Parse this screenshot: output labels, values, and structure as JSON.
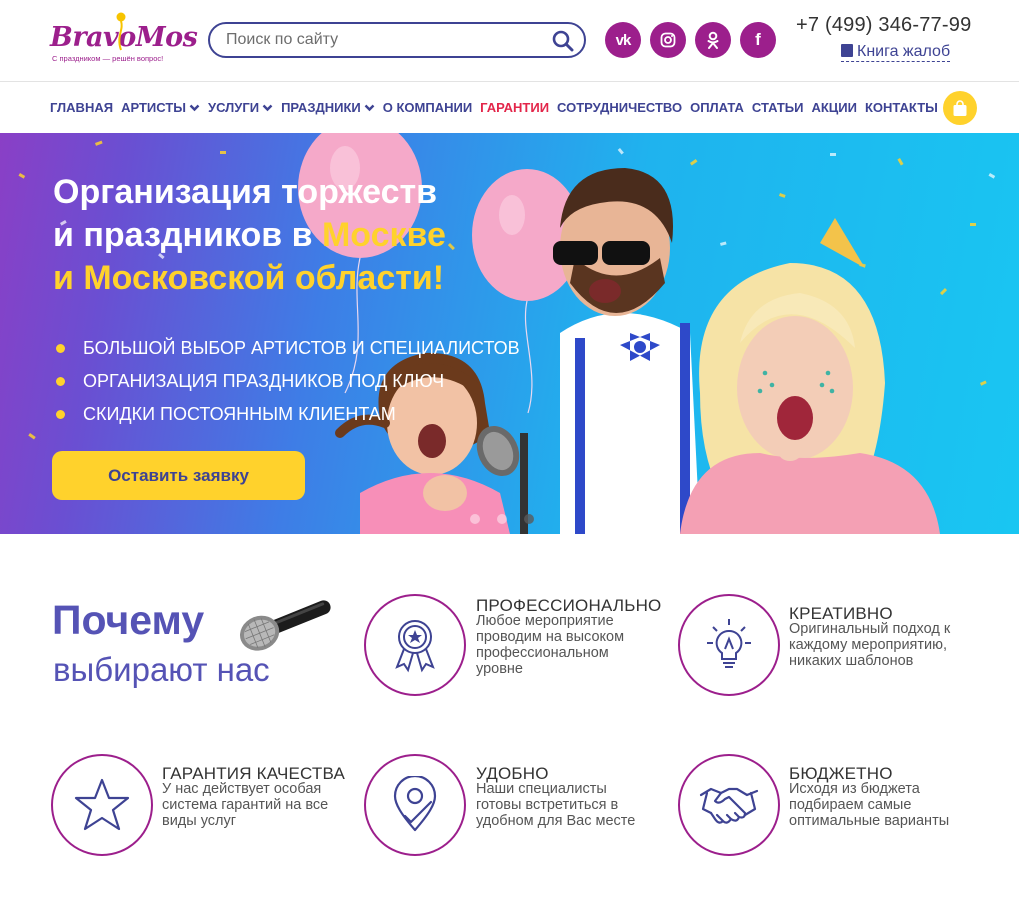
{
  "brand": {
    "logo_text": "BravoMos",
    "slogan": "С праздником — решён вопрос!",
    "accent": "#9c1f8c",
    "primary": "#3e4393",
    "yellow": "#ffd22c"
  },
  "header": {
    "search_placeholder": "Поиск по сайту",
    "socials": [
      {
        "name": "vk",
        "label": "vk"
      },
      {
        "name": "instagram",
        "label": ""
      },
      {
        "name": "odnoklassniki",
        "label": ""
      },
      {
        "name": "facebook",
        "label": "f"
      }
    ],
    "phone": "+7 (499) 346-77-99",
    "complaints_link": "Книга жалоб"
  },
  "nav": {
    "items": [
      {
        "label": "ГЛАВНАЯ",
        "dropdown": false,
        "active": false
      },
      {
        "label": "АРТИСТЫ",
        "dropdown": true,
        "active": false
      },
      {
        "label": "УСЛУГИ",
        "dropdown": true,
        "active": false
      },
      {
        "label": "ПРАЗДНИКИ",
        "dropdown": true,
        "active": false
      },
      {
        "label": "О КОМПАНИИ",
        "dropdown": false,
        "active": false
      },
      {
        "label": "ГАРАНТИИ",
        "dropdown": false,
        "active": true
      },
      {
        "label": "СОТРУДНИЧЕСТВО",
        "dropdown": false,
        "active": false
      },
      {
        "label": "ОПЛАТА",
        "dropdown": false,
        "active": false
      },
      {
        "label": "СТАТЬИ",
        "dropdown": false,
        "active": false
      },
      {
        "label": "АКЦИИ",
        "dropdown": false,
        "active": false
      },
      {
        "label": "КОНТАКТЫ",
        "dropdown": false,
        "active": false
      }
    ]
  },
  "hero": {
    "title_line1": "Организация торжеств",
    "title_line2_white": "и праздников в ",
    "title_line2_yellow": "Москве",
    "title_line3_yellow": "и Московской области!",
    "points": [
      "Большой выбор артистов и специалистов",
      "Организация праздников под ключ",
      "Скидки постоянным клиентам"
    ],
    "cta": "Оставить заявку",
    "slides_total": 3,
    "slide_active": 3
  },
  "why": {
    "title": "Почему",
    "subtitle": "выбирают нас",
    "features": [
      {
        "icon": "award-ribbon-icon",
        "title": "ПРОФЕССИОНАЛЬНО",
        "text": "Любое мероприятие проводим на высоком профессиональном уровне"
      },
      {
        "icon": "lightbulb-icon",
        "title": "КРЕАТИВНО",
        "text": "Оригинальный подход к каждому мероприятию, никаких шаблонов"
      },
      {
        "icon": "star-icon",
        "title": "ГАРАНТИЯ КАЧЕСТВА",
        "text": "У нас действует особая система гарантий на все виды услуг"
      },
      {
        "icon": "location-check-icon",
        "title": "УДОБНО",
        "text": "Наши специалисты готовы встретиться в удобном для Вас месте"
      },
      {
        "icon": "handshake-icon",
        "title": "БЮДЖЕТНО",
        "text": "Исходя из бюджета подбираем самые оптимальные варианты"
      }
    ]
  }
}
